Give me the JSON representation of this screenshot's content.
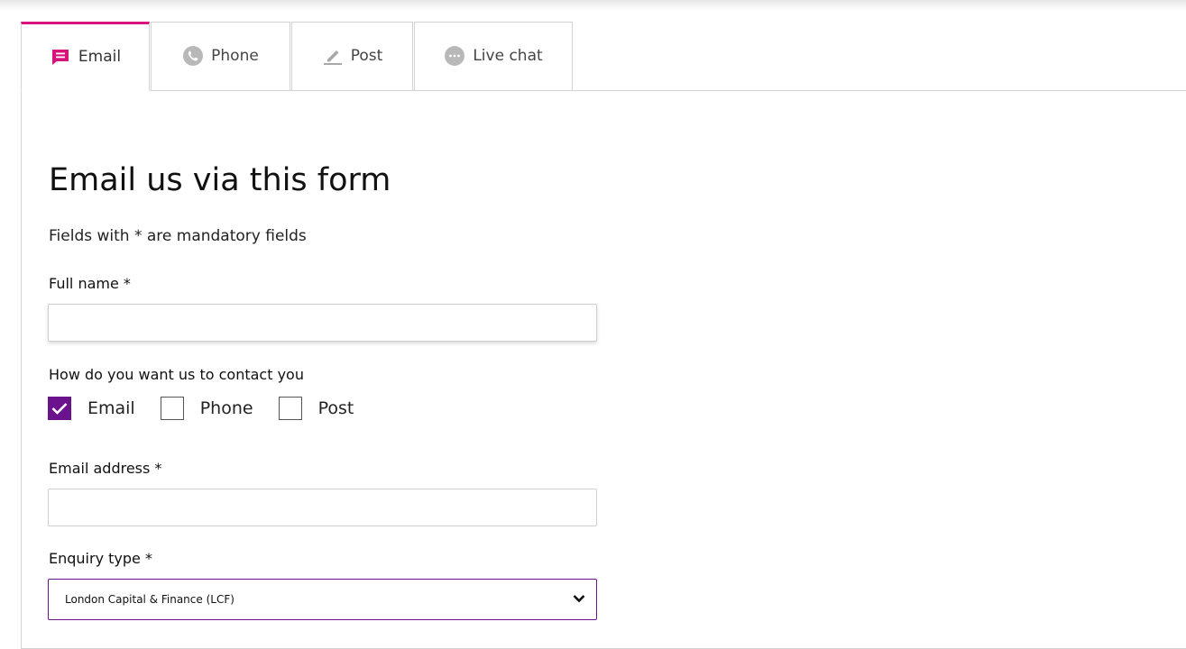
{
  "tabs": [
    {
      "label": "Email",
      "icon": "message-icon",
      "active": true
    },
    {
      "label": "Phone",
      "icon": "phone-icon",
      "active": false
    },
    {
      "label": "Post",
      "icon": "pencil-icon",
      "active": false
    },
    {
      "label": "Live chat",
      "icon": "chat-bubble-icon",
      "active": false
    }
  ],
  "form": {
    "title": "Email us via this form",
    "mandatory_note": "Fields with * are mandatory fields",
    "full_name_label": "Full name *",
    "full_name_value": "",
    "contact_label": "How do you want us to contact you",
    "contact_options": [
      {
        "label": "Email",
        "checked": true
      },
      {
        "label": "Phone",
        "checked": false
      },
      {
        "label": "Post",
        "checked": false
      }
    ],
    "email_label": "Email address *",
    "email_value": "",
    "enquiry_label": "Enquiry type *",
    "enquiry_selected": "London Capital & Finance (LCF)"
  },
  "colors": {
    "active_tab_accent": "#d6147c",
    "checkbox_fill": "#6b138c",
    "select_border": "#6b138c"
  }
}
